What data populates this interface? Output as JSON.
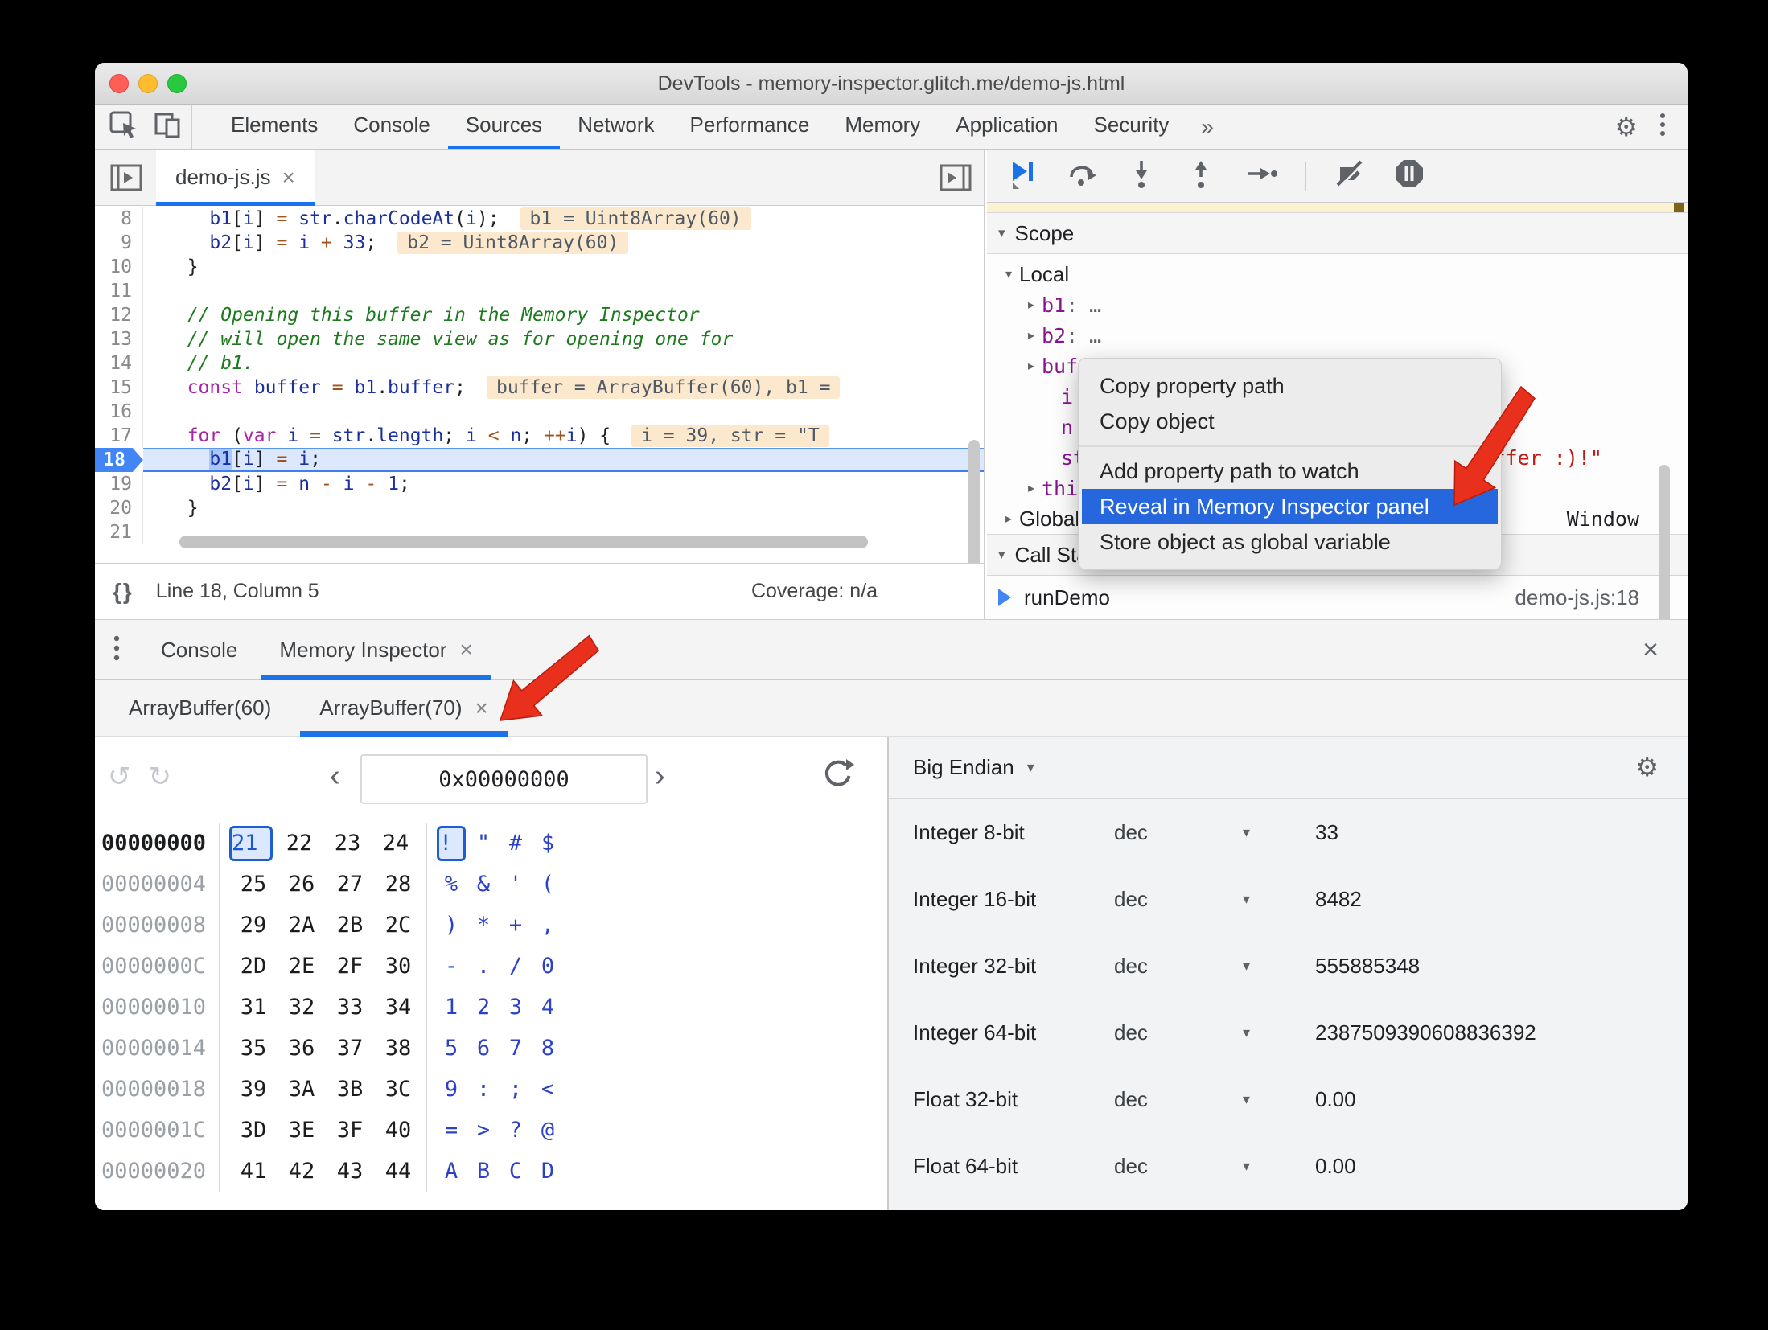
{
  "window": {
    "title": "DevTools - memory-inspector.glitch.me/demo-js.html"
  },
  "main_toolbar": {
    "tabs": [
      "Elements",
      "Console",
      "Sources",
      "Network",
      "Performance",
      "Memory",
      "Application",
      "Security"
    ],
    "active_tab": "Sources",
    "overflow_icon": "»"
  },
  "sources": {
    "file_tab": {
      "name": "demo-js.js",
      "close": "×"
    },
    "status_bar": {
      "brackets": "{}",
      "position": "Line 18, Column 5",
      "coverage": "Coverage: n/a"
    },
    "code_lines": [
      {
        "num": 8,
        "segs": [
          [
            "p",
            "    "
          ],
          [
            "v",
            "b1"
          ],
          [
            "p",
            "["
          ],
          [
            "v",
            "i"
          ],
          [
            "p",
            "] "
          ],
          [
            "o",
            "="
          ],
          [
            "p",
            " "
          ],
          [
            "v",
            "str"
          ],
          [
            "p",
            "."
          ],
          [
            "v",
            "charCodeAt"
          ],
          [
            "p",
            "("
          ],
          [
            "v",
            "i"
          ],
          [
            "p",
            ");"
          ]
        ],
        "chip": "b1 = Uint8Array(60)"
      },
      {
        "num": 9,
        "segs": [
          [
            "p",
            "    "
          ],
          [
            "v",
            "b2"
          ],
          [
            "p",
            "["
          ],
          [
            "v",
            "i"
          ],
          [
            "p",
            "] "
          ],
          [
            "o",
            "="
          ],
          [
            "p",
            " "
          ],
          [
            "v",
            "i"
          ],
          [
            "p",
            " "
          ],
          [
            "o",
            "+"
          ],
          [
            "p",
            " "
          ],
          [
            "v",
            "33"
          ],
          [
            "p",
            ";"
          ]
        ],
        "chip": "b2 = Uint8Array(60)"
      },
      {
        "num": 10,
        "segs": [
          [
            "p",
            "  }"
          ]
        ]
      },
      {
        "num": 11,
        "segs": []
      },
      {
        "num": 12,
        "segs": [
          [
            "c",
            "  // Opening this buffer in the Memory Inspector"
          ]
        ]
      },
      {
        "num": 13,
        "segs": [
          [
            "c",
            "  // will open the same view as for opening one for"
          ]
        ]
      },
      {
        "num": 14,
        "segs": [
          [
            "c",
            "  // b1."
          ]
        ]
      },
      {
        "num": 15,
        "segs": [
          [
            "p",
            "  "
          ],
          [
            "k",
            "const"
          ],
          [
            "p",
            " "
          ],
          [
            "v",
            "buffer"
          ],
          [
            "p",
            " "
          ],
          [
            "o",
            "="
          ],
          [
            "p",
            " "
          ],
          [
            "v",
            "b1"
          ],
          [
            "p",
            "."
          ],
          [
            "v",
            "buffer"
          ],
          [
            "p",
            ";"
          ]
        ],
        "chip": "buffer = ArrayBuffer(60), b1 ="
      },
      {
        "num": 16,
        "segs": []
      },
      {
        "num": 17,
        "segs": [
          [
            "p",
            "  "
          ],
          [
            "k",
            "for"
          ],
          [
            "p",
            " ("
          ],
          [
            "k",
            "var"
          ],
          [
            "p",
            " "
          ],
          [
            "v",
            "i"
          ],
          [
            "p",
            " "
          ],
          [
            "o",
            "="
          ],
          [
            "p",
            " "
          ],
          [
            "v",
            "str"
          ],
          [
            "p",
            "."
          ],
          [
            "v",
            "length"
          ],
          [
            "p",
            "; "
          ],
          [
            "v",
            "i"
          ],
          [
            "p",
            " "
          ],
          [
            "o",
            "<"
          ],
          [
            "p",
            " "
          ],
          [
            "v",
            "n"
          ],
          [
            "p",
            "; "
          ],
          [
            "o",
            "++"
          ],
          [
            "v",
            "i"
          ],
          [
            "p",
            ") {"
          ]
        ],
        "chip": "i = 39, str = \"T"
      },
      {
        "num": 18,
        "current": true,
        "segs": [
          [
            "p",
            "    "
          ],
          [
            "v sel",
            "b1"
          ],
          [
            "p",
            "["
          ],
          [
            "v",
            "i"
          ],
          [
            "p",
            "] "
          ],
          [
            "o",
            "="
          ],
          [
            "p",
            " "
          ],
          [
            "v",
            "i"
          ],
          [
            "p",
            ";"
          ]
        ]
      },
      {
        "num": 19,
        "segs": [
          [
            "p",
            "    "
          ],
          [
            "v",
            "b2"
          ],
          [
            "p",
            "["
          ],
          [
            "v",
            "i"
          ],
          [
            "p",
            "] "
          ],
          [
            "o",
            "="
          ],
          [
            "p",
            " "
          ],
          [
            "v",
            "n"
          ],
          [
            "p",
            " "
          ],
          [
            "o",
            "-"
          ],
          [
            "p",
            " "
          ],
          [
            "v",
            "i"
          ],
          [
            "p",
            " "
          ],
          [
            "o",
            "-"
          ],
          [
            "p",
            " "
          ],
          [
            "v",
            "1"
          ],
          [
            "p",
            ";"
          ]
        ]
      },
      {
        "num": 20,
        "segs": [
          [
            "p",
            "  }"
          ]
        ]
      },
      {
        "num": 21,
        "segs": []
      }
    ]
  },
  "debugger_pane": {
    "scope_title": "Scope",
    "call_stack_title": "Call Stack",
    "scope_items": [
      {
        "level": 0,
        "expander": "▾",
        "name": "Local",
        "section": true
      },
      {
        "level": 1,
        "expander": "▸",
        "name": "b1",
        "colon": ": ",
        "value": "…"
      },
      {
        "level": 1,
        "expander": "▸",
        "name": "b2",
        "colon": ": ",
        "value": "…"
      },
      {
        "level": 1,
        "expander": "▸",
        "name": "buffer",
        "colon": ": ",
        "value": ""
      },
      {
        "level": 2,
        "expander": "",
        "name": "i",
        "colon": ": ",
        "value": ""
      },
      {
        "level": 2,
        "expander": "",
        "name": "n",
        "colon": ": ",
        "value": ""
      },
      {
        "level": 2,
        "expander": "",
        "name": "str",
        "colon": ": ",
        "value": "",
        "right_value": "Buffer :)!\"",
        "right_color": "red"
      },
      {
        "level": 1,
        "expander": "▸",
        "name": "this",
        "colon": "",
        "value": ""
      },
      {
        "level": 0,
        "expander": "▸",
        "name": "Global",
        "section": true,
        "right_value": "Window"
      }
    ],
    "call_stack": [
      {
        "fn": "runDemo",
        "location": "demo-js.js:18",
        "active": true
      }
    ]
  },
  "context_menu": {
    "items": [
      "Copy property path",
      "Copy object",
      "separator",
      "Add property path to watch",
      "Reveal in Memory Inspector panel",
      "Store object as global variable"
    ],
    "highlighted": "Reveal in Memory Inspector panel"
  },
  "drawer": {
    "tabs": [
      "Console",
      "Memory Inspector"
    ],
    "active_tab": "Memory Inspector",
    "tab_close": "×",
    "close": "×"
  },
  "memory_inspector": {
    "buffer_tabs": [
      {
        "label": "ArrayBuffer(60)",
        "active": false,
        "closable": false
      },
      {
        "label": "ArrayBuffer(70)",
        "active": true,
        "closable": true
      }
    ],
    "navigation": {
      "address_value": "0x00000000"
    },
    "endianness": "Big Endian",
    "hex_rows": [
      {
        "addr": "00000000",
        "bytes": [
          "21",
          "22",
          "23",
          "24"
        ],
        "ascii": [
          "!",
          "\"",
          "#",
          "$"
        ],
        "sel": 0
      },
      {
        "addr": "00000004",
        "bytes": [
          "25",
          "26",
          "27",
          "28"
        ],
        "ascii": [
          "%",
          "&",
          "'",
          "("
        ]
      },
      {
        "addr": "00000008",
        "bytes": [
          "29",
          "2A",
          "2B",
          "2C"
        ],
        "ascii": [
          ")",
          "*",
          "+",
          ","
        ]
      },
      {
        "addr": "0000000C",
        "bytes": [
          "2D",
          "2E",
          "2F",
          "30"
        ],
        "ascii": [
          "-",
          ".",
          "/",
          "0"
        ]
      },
      {
        "addr": "00000010",
        "bytes": [
          "31",
          "32",
          "33",
          "34"
        ],
        "ascii": [
          "1",
          "2",
          "3",
          "4"
        ]
      },
      {
        "addr": "00000014",
        "bytes": [
          "35",
          "36",
          "37",
          "38"
        ],
        "ascii": [
          "5",
          "6",
          "7",
          "8"
        ]
      },
      {
        "addr": "00000018",
        "bytes": [
          "39",
          "3A",
          "3B",
          "3C"
        ],
        "ascii": [
          "9",
          ":",
          ";",
          "<"
        ]
      },
      {
        "addr": "0000001C",
        "bytes": [
          "3D",
          "3E",
          "3F",
          "40"
        ],
        "ascii": [
          "=",
          ">",
          "?",
          "@"
        ]
      },
      {
        "addr": "00000020",
        "bytes": [
          "41",
          "42",
          "43",
          "44"
        ],
        "ascii": [
          "A",
          "B",
          "C",
          "D"
        ]
      }
    ],
    "value_rows": [
      {
        "type": "Integer 8-bit",
        "format": "dec",
        "value": "33"
      },
      {
        "type": "Integer 16-bit",
        "format": "dec",
        "value": "8482"
      },
      {
        "type": "Integer 32-bit",
        "format": "dec",
        "value": "555885348"
      },
      {
        "type": "Integer 64-bit",
        "format": "dec",
        "value": "2387509390608836392"
      },
      {
        "type": "Float 32-bit",
        "format": "dec",
        "value": "0.00"
      },
      {
        "type": "Float 64-bit",
        "format": "dec",
        "value": "0.00"
      }
    ]
  },
  "colors": {
    "accent_blue": "#1a73e8",
    "menu_highlight": "#2667de",
    "arrow_red": "#e9301c",
    "string_red": "#c41a16"
  }
}
